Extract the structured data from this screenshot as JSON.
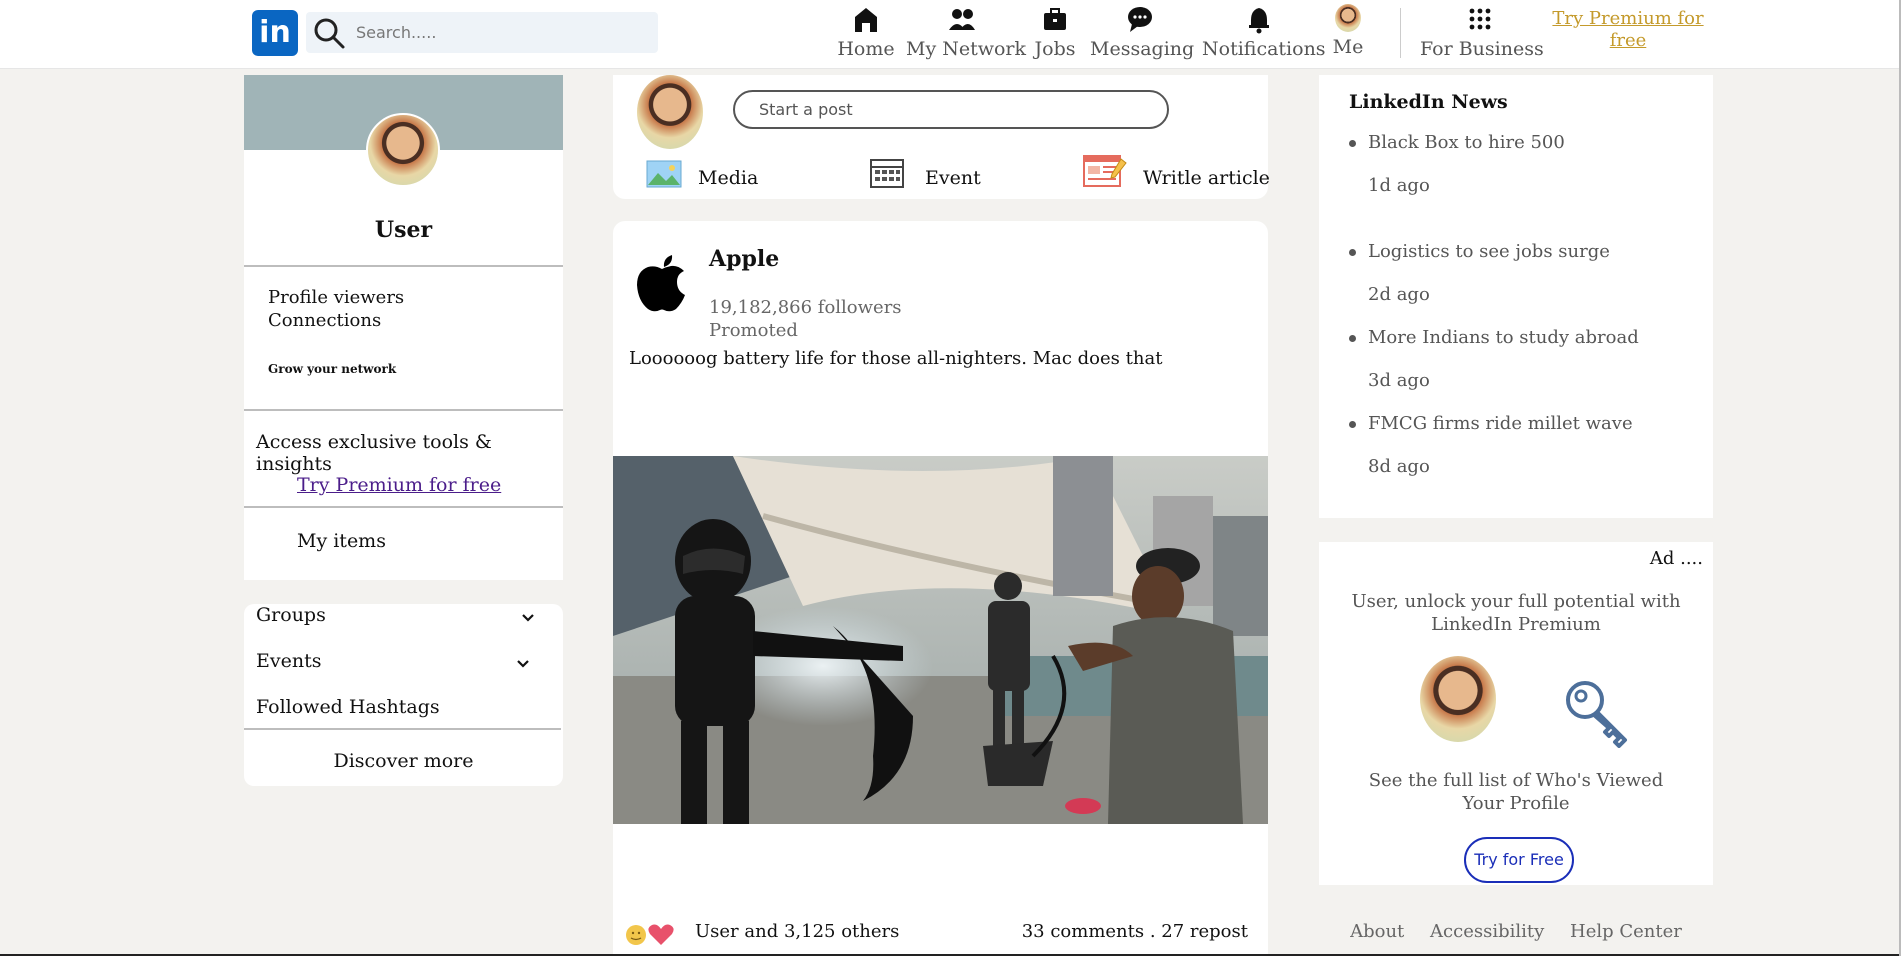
{
  "navbar": {
    "logo_text": "in",
    "search_placeholder": "Search.....",
    "items": [
      {
        "label": "Home",
        "icon": "home-icon"
      },
      {
        "label": "My Network",
        "icon": "network-icon"
      },
      {
        "label": "Jobs",
        "icon": "briefcase-icon"
      },
      {
        "label": "Messaging",
        "icon": "message-icon"
      },
      {
        "label": "Notifications",
        "icon": "bell-icon"
      },
      {
        "label": "Me",
        "icon": "avatar"
      }
    ],
    "business_label": "For Business",
    "premium_label": "Try Premium for free"
  },
  "profile": {
    "name": "User",
    "profile_viewers": "Profile viewers",
    "connections": "Connections",
    "grow": "Grow your network",
    "access": "Access exclusive tools & insights",
    "try_premium": "Try Premium for free",
    "my_items": "My items"
  },
  "groups": {
    "groups": "Groups",
    "events": "Events",
    "hashtags": "Followed Hashtags",
    "discover": "Discover more"
  },
  "composer": {
    "placeholder": "Start a post",
    "media": "Media",
    "event": "Event",
    "article": "Writle article"
  },
  "post": {
    "company": "Apple",
    "followers": "19,182,866 followers",
    "promoted": "Promoted",
    "text": "Loooooog battery life for those all-nighters. Mac does that",
    "likes": "User and 3,125 others",
    "comments": "33 comments . 27 repost"
  },
  "news": {
    "title": "LinkedIn News",
    "items": [
      {
        "headline": "Black Box to hire 500",
        "age": "1d ago"
      },
      {
        "headline": "Logistics to see jobs surge",
        "age": "2d ago"
      },
      {
        "headline": "More Indians to study abroad",
        "age": "3d ago"
      },
      {
        "headline": "FMCG firms ride millet wave",
        "age": "8d ago"
      }
    ]
  },
  "ad": {
    "label": "Ad ....",
    "headline": "User, unlock your full potential with LinkedIn Premium",
    "sub": "See the full list of Who's Viewed Your Profile",
    "button": "Try for Free"
  },
  "footer": {
    "about": "About",
    "accessibility": "Accessibility",
    "help": "Help Center"
  },
  "colors": {
    "brand": "#0a66c2",
    "premium_gold": "#c49a2b",
    "banner": "#a0b4b7",
    "link_purple": "#4b1d8a",
    "button_blue": "#1a2eb8"
  }
}
